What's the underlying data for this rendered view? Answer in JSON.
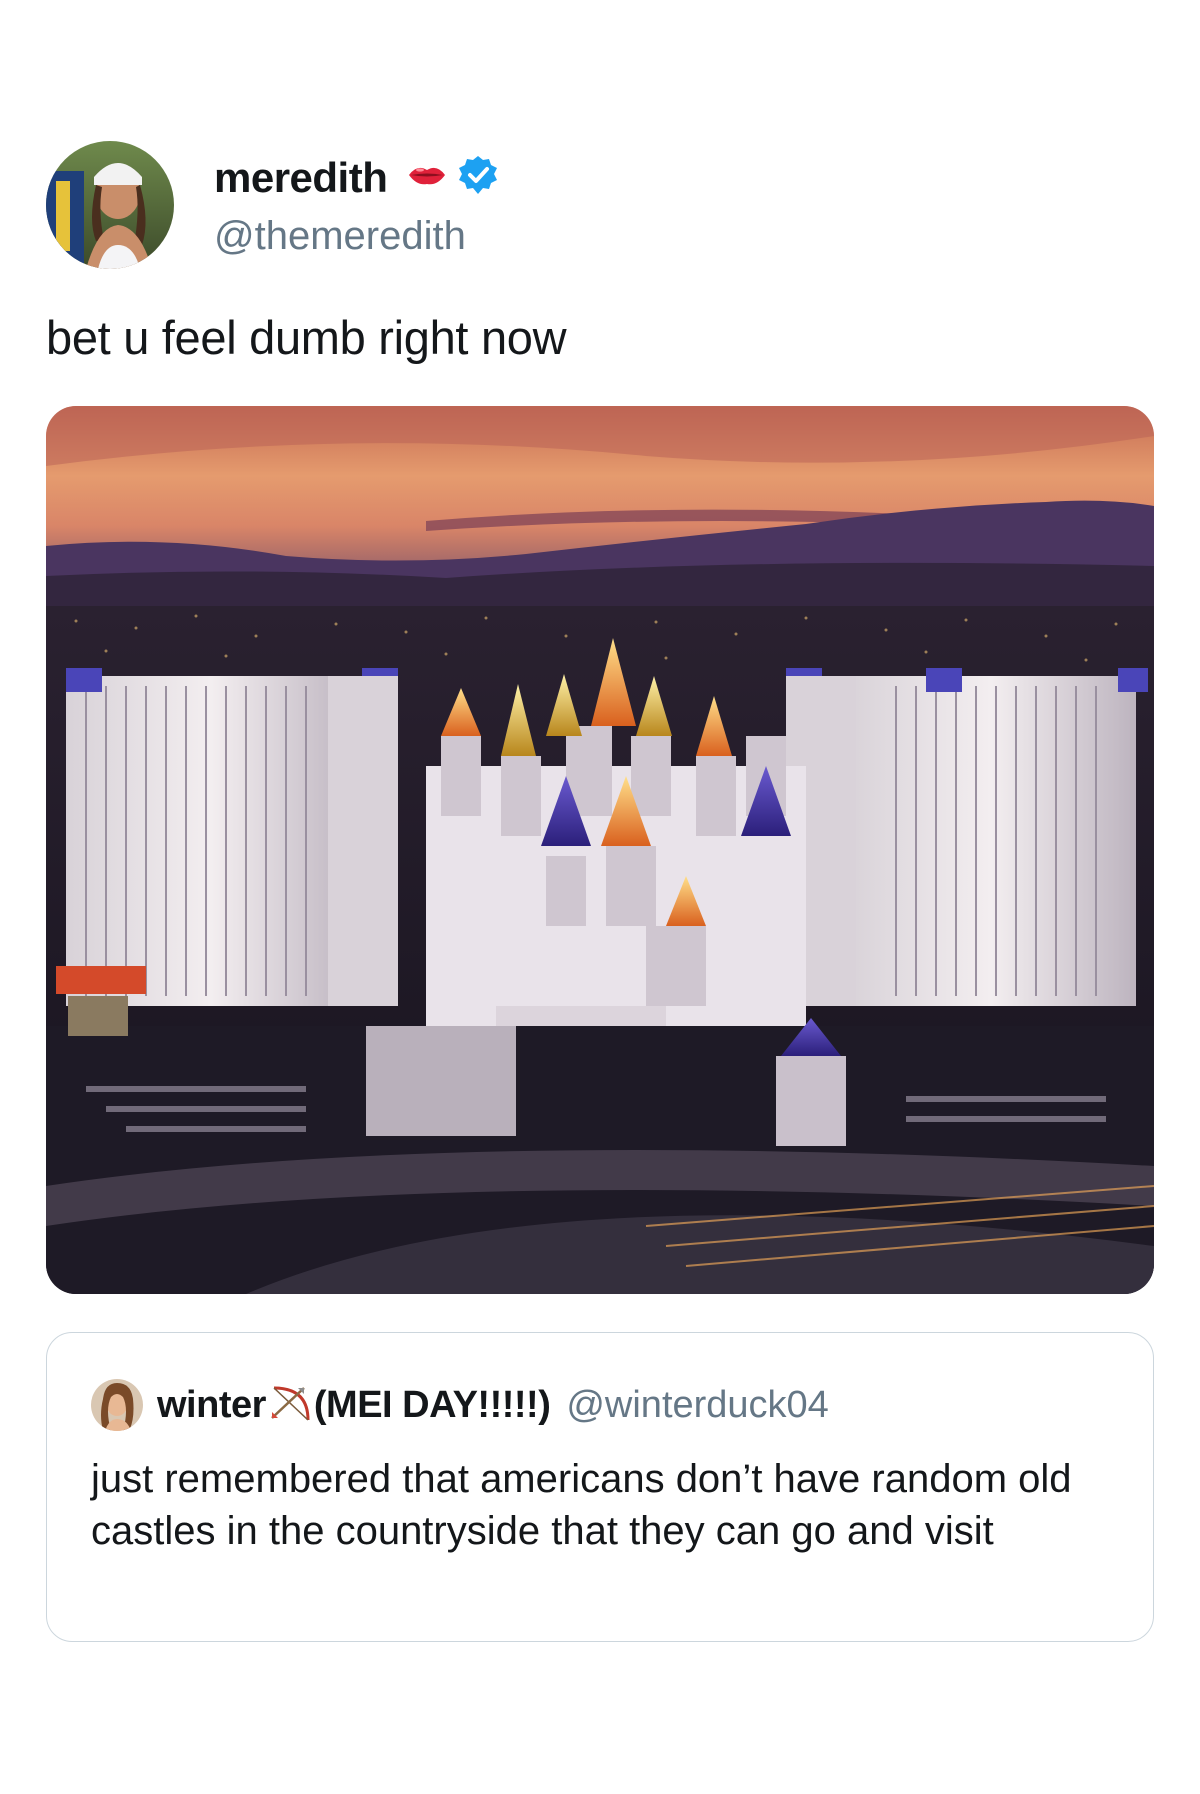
{
  "tweet": {
    "author": {
      "display_name": "meredith",
      "handle": "@themeredith",
      "verified": true,
      "name_emoji": "lips-icon"
    },
    "text": "bet u feel dumb right now",
    "media": {
      "description_icon": "photo-icon"
    },
    "quoted_tweet": {
      "author": {
        "display_name_part1": "winter",
        "name_emoji": "bow-and-arrow-icon",
        "display_name_part2": "(MEI DAY!!!!!)",
        "handle": "@winterduck04"
      },
      "text": "just remembered that americans don’t have random old castles in the countryside that they can go and visit"
    }
  },
  "colors": {
    "text_primary": "#14171a",
    "text_secondary": "#657786",
    "verified_blue": "#1da1f2",
    "border": "#ccd6dd"
  }
}
